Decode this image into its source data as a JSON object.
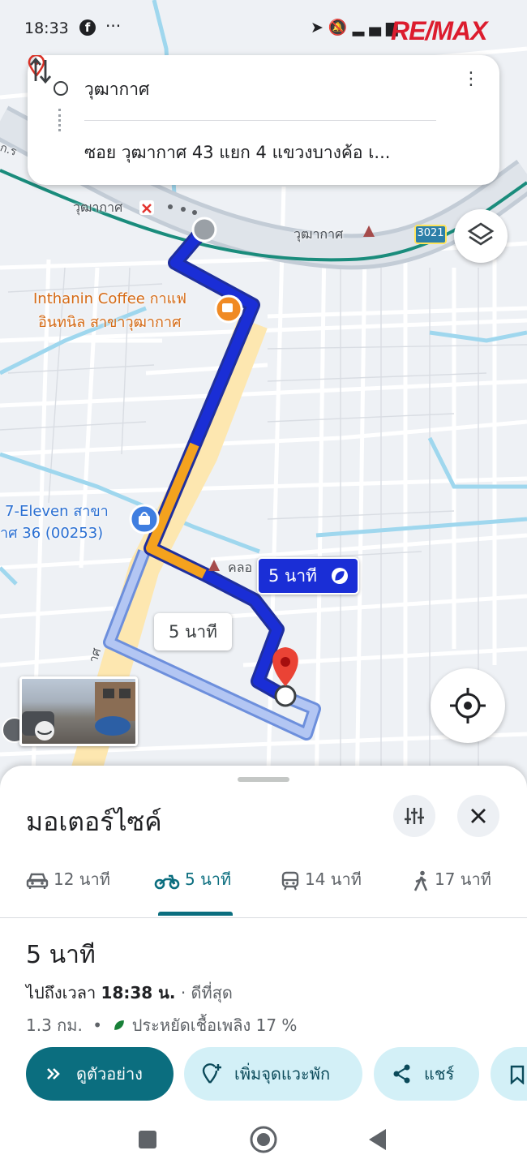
{
  "status_bar": {
    "time": "18:33",
    "facebook_icon_letter": "f",
    "overflow": "···",
    "watermark_text": "RE/MAX"
  },
  "directions": {
    "origin": "วุฒากาศ",
    "destination": "ซอย วุฒากาศ 43 แยก 4 แขวงบางค้อ เ..."
  },
  "map": {
    "poi_coffee_line1": "Inthanin Coffee กาแฟ",
    "poi_coffee_line2": "อินทนิล สาขาวุฒากาศ",
    "poi_711_line1": "7-Eleven สาขา",
    "poi_711_line2": "าศ 36 (00253)",
    "station_label_left": "วุฒากาศ",
    "station_label_right": "วุฒากาศ",
    "canal_label": "คลอ",
    "road_badge": "3021",
    "partial_road_label": "าศ",
    "partial_left_label": "ก.ร",
    "route_badge": "5 นาที",
    "alt_route_badge": "5 นาที"
  },
  "sheet": {
    "mode_title": "มอเตอร์ไซค์",
    "tabs": [
      {
        "icon": "car-icon",
        "label": "12 นาที"
      },
      {
        "icon": "motorcycle-icon",
        "label": "5 นาที",
        "active": true
      },
      {
        "icon": "transit-icon",
        "label": "14 นาที"
      },
      {
        "icon": "walk-icon",
        "label": "17 นาที"
      }
    ],
    "duration": "5 นาที",
    "arrival_prefix": "ไปถึงเวลา",
    "arrival_time": "18:38 น.",
    "arrival_suffix": "· ดีที่สุด",
    "distance": "1.3 กม.",
    "eco_text": "ประหยัดเชื้อเพลิง 17 %",
    "buttons": {
      "preview": "ดูตัวอย่าง",
      "add_stop": "เพิ่มจุดแวะพัก",
      "share": "แชร์"
    }
  },
  "colors": {
    "route_primary": "#1a2ed6",
    "route_slow": "#f4a21e",
    "route_alt": "#a9bdf0",
    "accent_teal": "#0b6e7f",
    "pin_red": "#ea4335"
  }
}
